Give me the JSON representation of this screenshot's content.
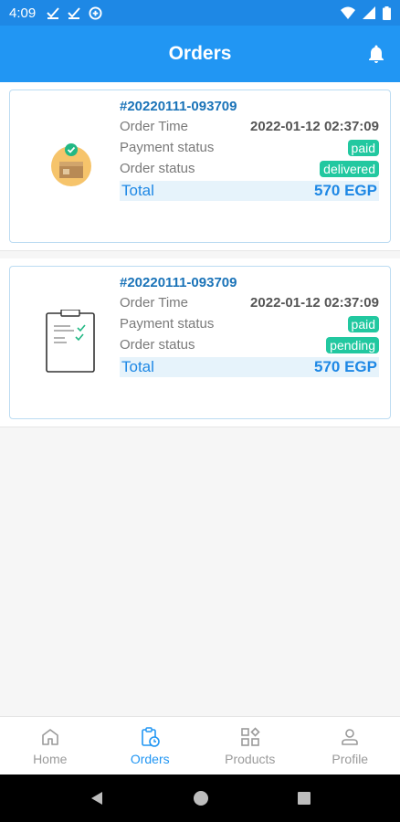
{
  "status_bar": {
    "time": "4:09"
  },
  "app_bar": {
    "title": "Orders"
  },
  "orders": [
    {
      "id": "#20220111-093709",
      "time_label": "Order Time",
      "time": "2022-01-12 02:37:09",
      "payment_label": "Payment status",
      "payment": "paid",
      "status_label": "Order status",
      "status": "delivered",
      "total_label": "Total",
      "total": "570 EGP",
      "icon": "delivered-box-icon"
    },
    {
      "id": "#20220111-093709",
      "time_label": "Order Time",
      "time": "2022-01-12 02:37:09",
      "payment_label": "Payment status",
      "payment": "paid",
      "status_label": "Order status",
      "status": "pending",
      "total_label": "Total",
      "total": "570 EGP",
      "icon": "clipboard-icon"
    }
  ],
  "bottom_nav": {
    "items": [
      {
        "label": "Home",
        "icon": "home-icon"
      },
      {
        "label": "Orders",
        "icon": "orders-icon",
        "active": true
      },
      {
        "label": "Products",
        "icon": "products-icon"
      },
      {
        "label": "Profile",
        "icon": "profile-icon"
      }
    ]
  },
  "colors": {
    "primary": "#2196f3",
    "status_badge": "#22c8a0",
    "order_id": "#1a73b8"
  }
}
